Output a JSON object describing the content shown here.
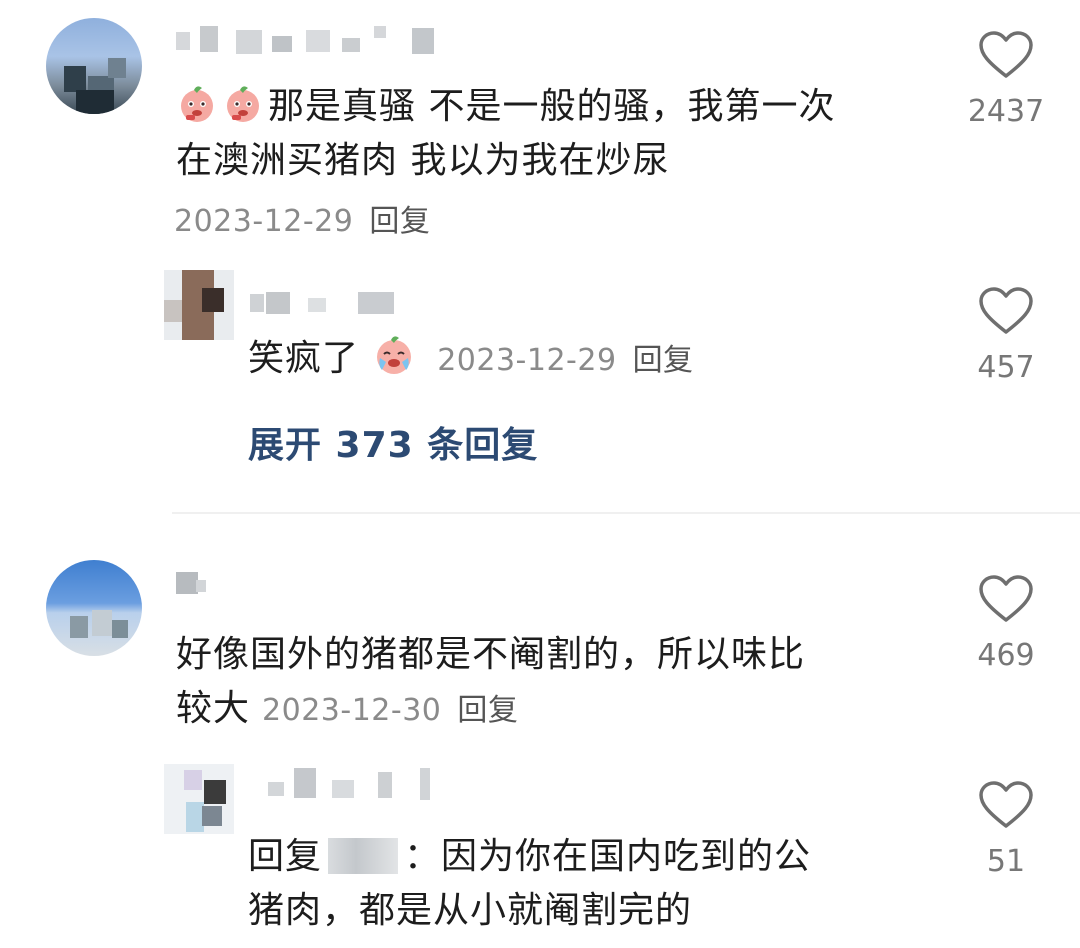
{
  "comments": [
    {
      "emojis": [
        "peach-emoji",
        "peach-emoji"
      ],
      "text_line1": "那是真骚 不是一般的骚，我第一次",
      "text_line2": "在澳洲买猪肉 我以为我在炒尿",
      "date": "2023-12-29",
      "reply_label": "回复",
      "likes": "2437",
      "replies": [
        {
          "text": "笑疯了",
          "emoji": "crying-peach-emoji",
          "date": "2023-12-29",
          "reply_label": "回复",
          "likes": "457"
        }
      ],
      "expand_label": "展开 373 条回复"
    },
    {
      "text_line1": "好像国外的猪都是不阉割的，所以味比",
      "text_line2": "较大",
      "date": "2023-12-30",
      "reply_label": "回复",
      "likes": "469",
      "replies": [
        {
          "prefix": "回复",
          "text_line1": "：因为你在国内吃到的公",
          "text_line2": "猪肉，都是从小就阉割完的",
          "likes": "51"
        }
      ]
    }
  ],
  "colors": {
    "link_blue": "#2c4a73",
    "meta_gray": "#8a8a8a",
    "heart_stroke": "#6f6f6f"
  }
}
